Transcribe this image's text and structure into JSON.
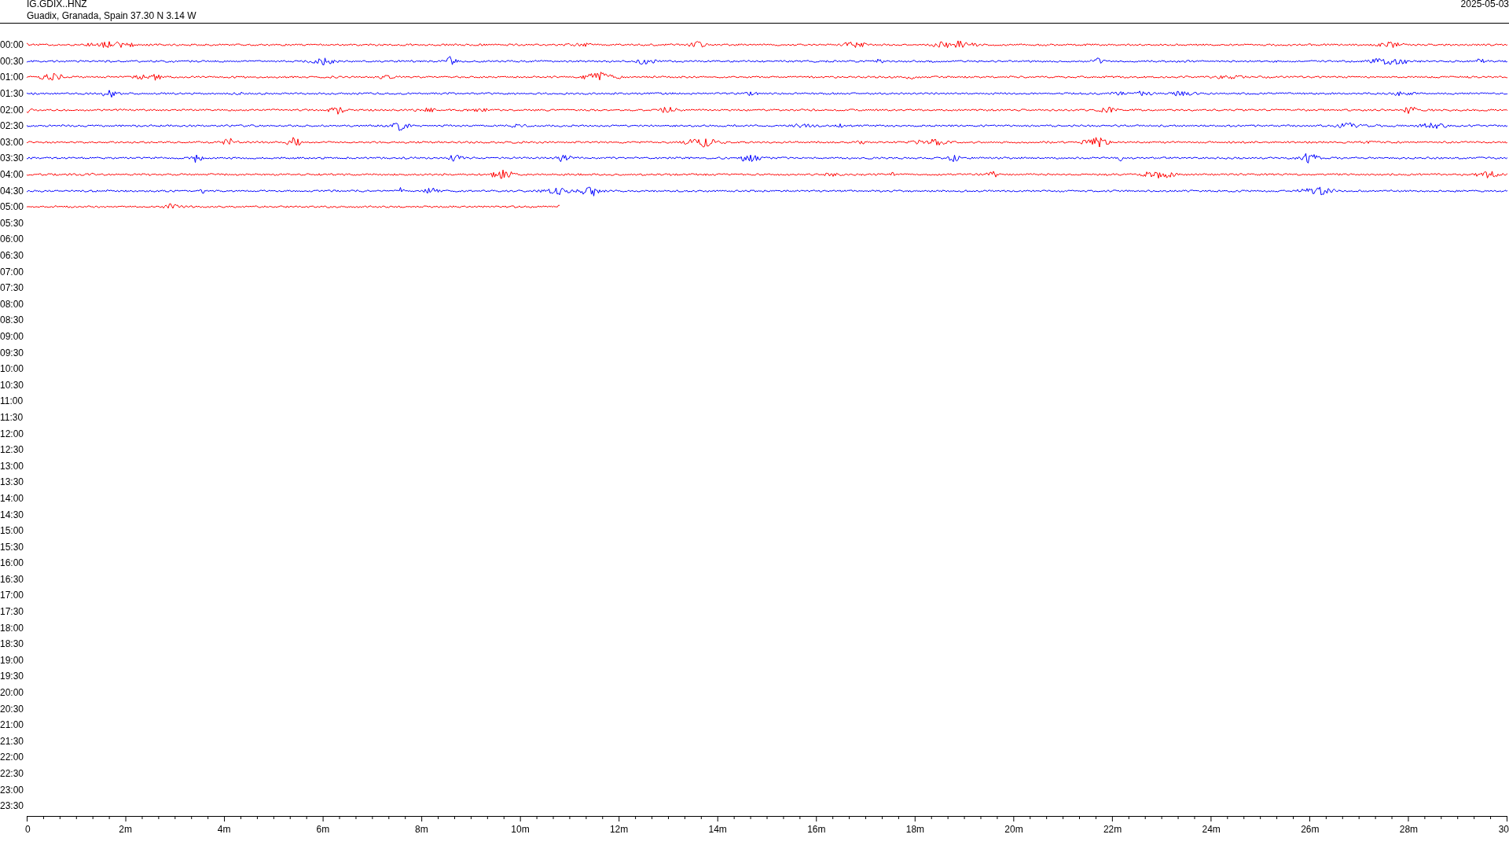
{
  "header": {
    "station": "IG.GDIX..HNZ",
    "location": "Guadix, Granada, Spain  37.30 N 3.14 W",
    "date": "2025-05-03"
  },
  "rows": [
    {
      "label": "00:00",
      "color": "#ff0000",
      "level": 1
    },
    {
      "label": "00:30",
      "color": "#0000ff",
      "level": 1
    },
    {
      "label": "01:00",
      "color": "#ff0000",
      "level": 1
    },
    {
      "label": "01:30",
      "color": "#0000ff",
      "level": 1
    },
    {
      "label": "02:00",
      "color": "#ff0000",
      "level": 1
    },
    {
      "label": "02:30",
      "color": "#0000ff",
      "level": 1
    },
    {
      "label": "03:00",
      "color": "#ff0000",
      "level": 1
    },
    {
      "label": "03:30",
      "color": "#0000ff",
      "level": 1
    },
    {
      "label": "04:00",
      "color": "#ff0000",
      "level": 1
    },
    {
      "label": "04:30",
      "color": "#0000ff",
      "level": 1
    },
    {
      "label": "05:00",
      "color": "#ff0000",
      "level": 0.36
    },
    {
      "label": "05:30"
    },
    {
      "label": "06:00"
    },
    {
      "label": "06:30"
    },
    {
      "label": "07:00"
    },
    {
      "label": "07:30"
    },
    {
      "label": "08:00"
    },
    {
      "label": "08:30"
    },
    {
      "label": "09:00"
    },
    {
      "label": "09:30"
    },
    {
      "label": "10:00"
    },
    {
      "label": "10:30"
    },
    {
      "label": "11:00"
    },
    {
      "label": "11:30"
    },
    {
      "label": "12:00"
    },
    {
      "label": "12:30"
    },
    {
      "label": "13:00"
    },
    {
      "label": "13:30"
    },
    {
      "label": "14:00"
    },
    {
      "label": "14:30"
    },
    {
      "label": "15:00"
    },
    {
      "label": "15:30"
    },
    {
      "label": "16:00"
    },
    {
      "label": "16:30"
    },
    {
      "label": "17:00"
    },
    {
      "label": "17:30"
    },
    {
      "label": "18:00"
    },
    {
      "label": "18:30"
    },
    {
      "label": "19:00"
    },
    {
      "label": "19:30"
    },
    {
      "label": "20:00"
    },
    {
      "label": "20:30"
    },
    {
      "label": "21:00"
    },
    {
      "label": "21:30"
    },
    {
      "label": "22:00"
    },
    {
      "label": "22:30"
    },
    {
      "label": "23:00"
    },
    {
      "label": "23:30"
    }
  ],
  "x_axis": {
    "labels": [
      "0",
      "2m",
      "4m",
      "6m",
      "8m",
      "10m",
      "12m",
      "14m",
      "16m",
      "18m",
      "20m",
      "22m",
      "24m",
      "26m",
      "28m",
      "30"
    ]
  }
}
